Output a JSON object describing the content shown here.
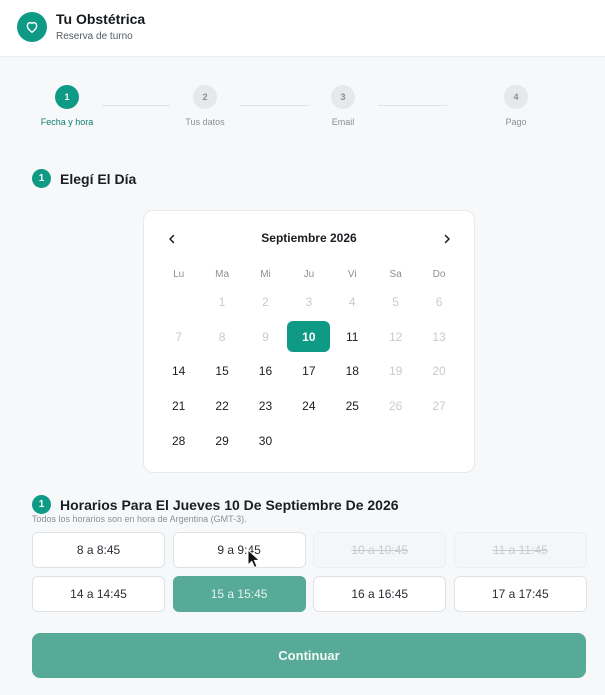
{
  "header": {
    "title": "Tu Obstétrica",
    "subtitle": "Reserva de turno",
    "logo_icon": "heart-icon"
  },
  "stepper": {
    "steps": [
      {
        "number": "1",
        "label": "Fecha y hora",
        "active": true
      },
      {
        "number": "2",
        "label": "Tus datos",
        "active": false
      },
      {
        "number": "3",
        "label": "Email",
        "active": false
      },
      {
        "number": "4",
        "label": "Pago",
        "active": false
      }
    ]
  },
  "day_section": {
    "badge": "1",
    "title": "Elegí El Día"
  },
  "calendar": {
    "month_label": "Septiembre 2026",
    "prev_icon": "chevron-left-icon",
    "next_icon": "chevron-right-icon",
    "weekdays": [
      "Lu",
      "Ma",
      "Mi",
      "Ju",
      "Vi",
      "Sa",
      "Do"
    ],
    "weeks": [
      [
        {
          "n": "",
          "s": "blank"
        },
        {
          "n": "1",
          "s": "disabled"
        },
        {
          "n": "2",
          "s": "disabled"
        },
        {
          "n": "3",
          "s": "disabled"
        },
        {
          "n": "4",
          "s": "disabled"
        },
        {
          "n": "5",
          "s": "disabled"
        },
        {
          "n": "6",
          "s": "disabled"
        }
      ],
      [
        {
          "n": "7",
          "s": "disabled"
        },
        {
          "n": "8",
          "s": "disabled"
        },
        {
          "n": "9",
          "s": "disabled"
        },
        {
          "n": "10",
          "s": "selected"
        },
        {
          "n": "11",
          "s": "available"
        },
        {
          "n": "12",
          "s": "disabled"
        },
        {
          "n": "13",
          "s": "disabled"
        }
      ],
      [
        {
          "n": "14",
          "s": "available"
        },
        {
          "n": "15",
          "s": "available"
        },
        {
          "n": "16",
          "s": "available"
        },
        {
          "n": "17",
          "s": "available"
        },
        {
          "n": "18",
          "s": "available"
        },
        {
          "n": "19",
          "s": "disabled"
        },
        {
          "n": "20",
          "s": "disabled"
        }
      ],
      [
        {
          "n": "21",
          "s": "available"
        },
        {
          "n": "22",
          "s": "available"
        },
        {
          "n": "23",
          "s": "available"
        },
        {
          "n": "24",
          "s": "available"
        },
        {
          "n": "25",
          "s": "available"
        },
        {
          "n": "26",
          "s": "disabled"
        },
        {
          "n": "27",
          "s": "disabled"
        }
      ],
      [
        {
          "n": "28",
          "s": "available"
        },
        {
          "n": "29",
          "s": "available"
        },
        {
          "n": "30",
          "s": "available"
        },
        {
          "n": "",
          "s": "blank"
        },
        {
          "n": "",
          "s": "blank"
        },
        {
          "n": "",
          "s": "blank"
        },
        {
          "n": "",
          "s": "blank"
        }
      ]
    ]
  },
  "time_section": {
    "badge": "1",
    "title": "Horarios Para El Jueves 10 De Septiembre De 2026",
    "note": "Todos los horarios son en hora de Argentina (GMT-3).",
    "slots": [
      {
        "label": "8 a 8:45",
        "state": "available"
      },
      {
        "label": "9 a 9:45",
        "state": "available"
      },
      {
        "label": "10 a 10:45",
        "state": "unavailable"
      },
      {
        "label": "11 a 11:45",
        "state": "unavailable"
      },
      {
        "label": "14 a 14:45",
        "state": "available"
      },
      {
        "label": "15 a 15:45",
        "state": "selected"
      },
      {
        "label": "16 a 16:45",
        "state": "available"
      },
      {
        "label": "17 a 17:45",
        "state": "available"
      }
    ]
  },
  "continue_label": "Continuar",
  "colors": {
    "accent": "#0f9a85",
    "accent_muted": "#58aa98"
  }
}
